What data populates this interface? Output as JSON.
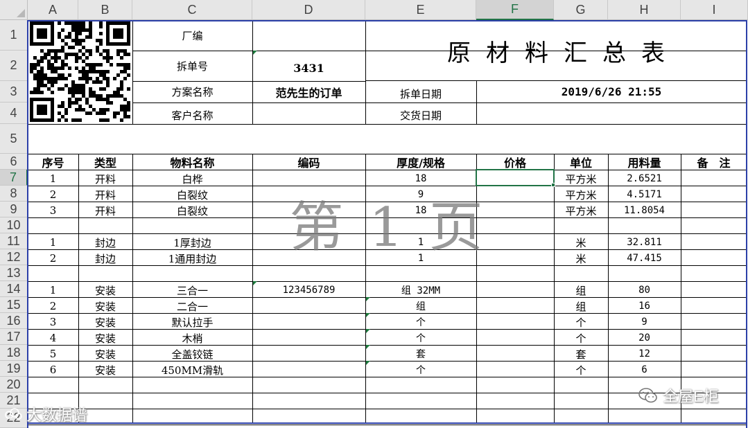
{
  "columns": [
    "A",
    "B",
    "C",
    "D",
    "E",
    "F",
    "G",
    "H",
    "I"
  ],
  "rows": [
    "1",
    "2",
    "3",
    "4",
    "5",
    "6",
    "7",
    "8",
    "9",
    "10",
    "11",
    "12",
    "13",
    "14",
    "15",
    "16",
    "17",
    "18",
    "19",
    "20",
    "21",
    "22"
  ],
  "selected": {
    "column": "F",
    "row": "7"
  },
  "header": {
    "factory_label": "厂编",
    "factory_value": "",
    "order_split_label": "拆单号",
    "order_split_value": "3431",
    "plan_name_label": "方案名称",
    "plan_name_value": "范先生的订单",
    "customer_label": "客户名称",
    "customer_value": "",
    "split_date_label": "拆单日期",
    "split_date_value": "2019/6/26 21:55",
    "delivery_date_label": "交货日期",
    "delivery_date_value": "",
    "title": "原材料汇总表"
  },
  "table_headers": [
    "序号",
    "类型",
    "物料名称",
    "编码",
    "厚度/规格",
    "价格",
    "单位",
    "用料量",
    "备　注"
  ],
  "table_rows": [
    [
      "1",
      "开料",
      "白桦",
      "",
      "18",
      "",
      "平方米",
      "2.6521",
      ""
    ],
    [
      "2",
      "开料",
      "白裂纹",
      "",
      "9",
      "",
      "平方米",
      "4.5171",
      ""
    ],
    [
      "3",
      "开料",
      "白裂纹",
      "",
      "18",
      "",
      "平方米",
      "11.8054",
      ""
    ],
    [
      "",
      "",
      "",
      "",
      "",
      "",
      "",
      "",
      ""
    ],
    [
      "1",
      "封边",
      "1厚封边",
      "",
      "1",
      "",
      "米",
      "32.811",
      ""
    ],
    [
      "2",
      "封边",
      "1通用封边",
      "",
      "1",
      "",
      "米",
      "47.415",
      ""
    ],
    [
      "",
      "",
      "",
      "",
      "",
      "",
      "",
      "",
      ""
    ],
    [
      "1",
      "安装",
      "三合一",
      "123456789",
      "组 32MM",
      "",
      "组",
      "80",
      ""
    ],
    [
      "2",
      "安装",
      "二合一",
      "",
      "组",
      "",
      "组",
      "16",
      ""
    ],
    [
      "3",
      "安装",
      "默认拉手",
      "",
      "个",
      "",
      "个",
      "9",
      ""
    ],
    [
      "4",
      "安装",
      "木梢",
      "",
      "个",
      "",
      "个",
      "20",
      ""
    ],
    [
      "5",
      "安装",
      "全盖铰链",
      "",
      "套",
      "",
      "套",
      "12",
      ""
    ],
    [
      "6",
      "安装",
      "450MM滑轨",
      "",
      "个",
      "",
      "个",
      "6",
      ""
    ],
    [
      "",
      "",
      "",
      "",
      "",
      "",
      "",
      "",
      ""
    ],
    [
      "",
      "",
      "",
      "",
      "",
      "",
      "",
      "",
      ""
    ],
    [
      "",
      "",
      "",
      "",
      "",
      "",
      "",
      "",
      ""
    ]
  ],
  "page_watermark": "第 1 页",
  "watermarks": {
    "left": "大数据谱",
    "right": "全屋E柜"
  },
  "icons": [
    "qr-code-icon",
    "wechat-icon"
  ],
  "colors": {
    "selection": "#217346",
    "border": "#000000",
    "print_area": "#2b3fa8"
  }
}
